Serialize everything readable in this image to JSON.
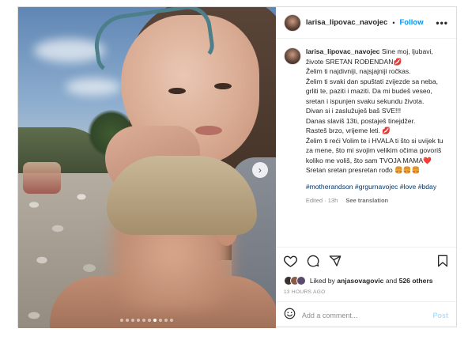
{
  "post": {
    "username": "larisa_lipovac_navojec",
    "separator": "•",
    "follow_label": "Follow",
    "more_label": "•••",
    "next_label": "›",
    "carousel": {
      "count": 10,
      "active_index": 6
    },
    "caption": {
      "username": "larisa_lipovac_navojec",
      "lines": [
        "Sine moj, ljubavi, živote SRETAN ROĐENDAN💋",
        "Želim ti najdivniji, najsjajniji ročkas.",
        "Želim ti svaki dan spuštati zvijezde sa neba, grliti te, paziti i maziti. Da mi budeš veseo, sretan i ispunjen svaku sekundu života.",
        "Divan si i zaslužuješ baš SVE!!!",
        "Danas slaviš 13ti, postaješ tinejdžer.",
        "Rasteš brzo, vrijeme leti. 💋",
        "Želim ti reći Volim te i HVALA ti što si uvijek tu za mene, što mi svojim velikim očima govoriš koliko me voliš, što sam TVOJA MAMA❤️",
        "Sretan sretan presretan rođo 🍔🍔🍔"
      ],
      "hashtags": "#motherandson #grgurnavojec #love #bday",
      "edited": "Edited · 13h",
      "see_translation": "See translation"
    },
    "likes": {
      "prefix": "Liked by",
      "user": "anjasovagovic",
      "connector": "and",
      "others": "526 others"
    },
    "time_ago": "13 HOURS AGO",
    "comment": {
      "placeholder": "Add a comment...",
      "post_label": "Post"
    },
    "icons": {
      "like": "heart-icon",
      "comment": "comment-icon",
      "share": "share-icon",
      "save": "bookmark-icon",
      "emoji": "emoji-icon"
    },
    "colors": {
      "link": "#0095f6",
      "hashtag": "#00376b",
      "muted": "#8e8e8e",
      "post_disabled": "#b2dffc"
    }
  }
}
